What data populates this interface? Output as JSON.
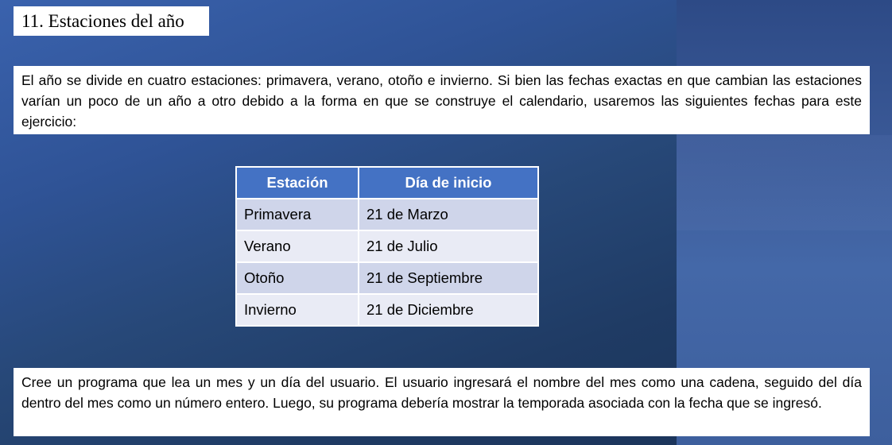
{
  "slide": {
    "title": "11. Estaciones del año",
    "intro": "El año se divide en cuatro estaciones: primavera, verano, otoño e invierno. Si bien las fechas exactas en que cambian las estaciones varían un poco de un año a otro debido a la forma en que se construye el calendario, usaremos las siguientes fechas para este ejercicio:",
    "outro": "Cree un programa que lea un mes y un día del usuario. El usuario ingresará el nombre del mes como una cadena, seguido del día dentro del mes como un número entero. Luego, su programa debería mostrar la temporada asociada con la fecha que se ingresó."
  },
  "table": {
    "headers": [
      "Estación",
      "Día de inicio"
    ],
    "rows": [
      [
        "Primavera",
        "21 de Marzo"
      ],
      [
        "Verano",
        "21 de Julio"
      ],
      [
        "Otoño",
        "21 de Septiembre"
      ],
      [
        "Invierno",
        "21 de Diciembre"
      ]
    ]
  },
  "colors": {
    "header_bg": "#4472c4",
    "row_odd_bg": "#cfd5ea",
    "row_even_bg": "#e9ebf5",
    "background": "#2f5396"
  }
}
